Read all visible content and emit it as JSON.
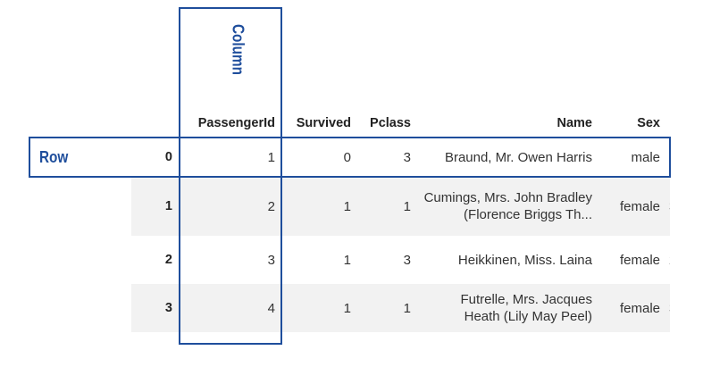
{
  "annotations": {
    "row_label": "Row",
    "column_label": "Column",
    "color": "#1f4e9c"
  },
  "table": {
    "columns": [
      "",
      "PassengerId",
      "Survived",
      "Pclass",
      "Name",
      "Sex",
      ""
    ],
    "rows": [
      {
        "index": "0",
        "PassengerId": "1",
        "Survived": "0",
        "Pclass": "3",
        "Name": "Braund, Mr. Owen Harris",
        "Sex": "male",
        "clipped": ""
      },
      {
        "index": "1",
        "PassengerId": "2",
        "Survived": "1",
        "Pclass": "1",
        "Name": "Cumings, Mrs. John Bradley (Florence Briggs Th...",
        "Sex": "female",
        "clipped": "3"
      },
      {
        "index": "2",
        "PassengerId": "3",
        "Survived": "1",
        "Pclass": "3",
        "Name": "Heikkinen, Miss. Laina",
        "Sex": "female",
        "clipped": "2"
      },
      {
        "index": "3",
        "PassengerId": "4",
        "Survived": "1",
        "Pclass": "1",
        "Name": "Futrelle, Mrs. Jacques Heath (Lily May Peel)",
        "Sex": "female",
        "clipped": "3"
      }
    ]
  }
}
